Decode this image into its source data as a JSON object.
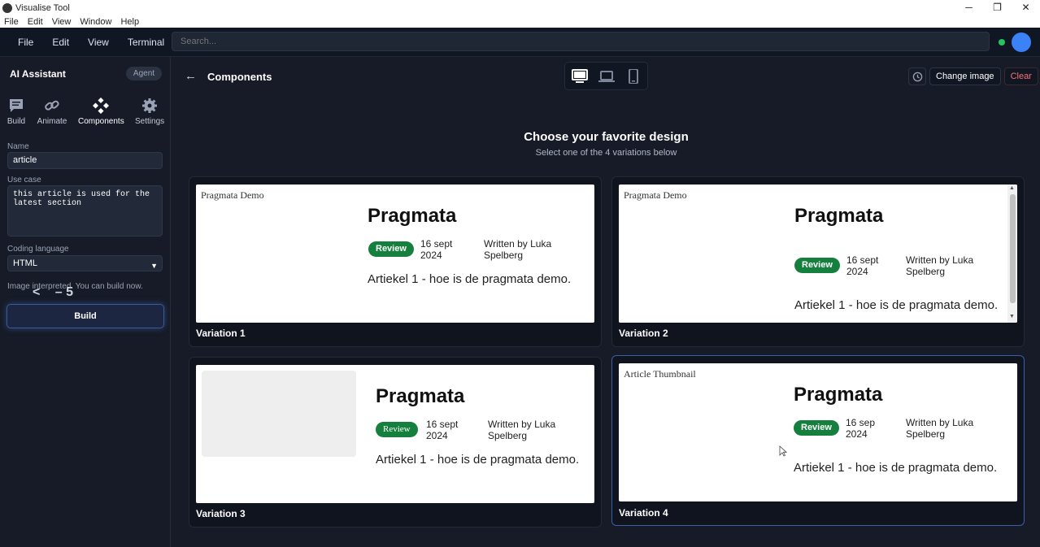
{
  "window": {
    "title": "Visualise Tool",
    "menu": [
      "File",
      "Edit",
      "View",
      "Window",
      "Help"
    ],
    "controls": [
      "─",
      "❐",
      "✕"
    ]
  },
  "appbar": {
    "menu": [
      "File",
      "Edit",
      "View",
      "Terminal"
    ],
    "search_placeholder": "Search...",
    "status_color": "#22c55e",
    "avatar_color": "#3b82f6"
  },
  "sidebar": {
    "title": "AI Assistant",
    "agent_badge": "Agent",
    "tabs": [
      {
        "label": "Build",
        "icon": "chat-icon"
      },
      {
        "label": "Animate",
        "icon": "link-icon"
      },
      {
        "label": "Components",
        "icon": "components-icon"
      },
      {
        "label": "Settings",
        "icon": "gear-icon"
      }
    ],
    "name_label": "Name",
    "name_value": "article",
    "usecase_label": "Use case",
    "usecase_value": "this article is used for the latest section",
    "language_label": "Coding language",
    "language_value": "HTML",
    "status_text": "Image interpreted. You can build now.",
    "overlay_arrow": "<",
    "overlay_text": "– 5",
    "build_label": "Build"
  },
  "main": {
    "back_label": "←",
    "title": "Components",
    "change_image_label": "Change image",
    "clear_label": "Clear",
    "choose_title": "Choose your favorite design",
    "choose_subtitle": "Select one of the 4 variations below",
    "variations": [
      {
        "label": "Variation 1",
        "img_alt": "Pragmata Demo",
        "title": "Pragmata",
        "badge": "Review",
        "date": "16 sept 2024",
        "author": "Written by Luka Spelberg",
        "text": "Artiekel 1 - hoe is de pragmata demo."
      },
      {
        "label": "Variation 2",
        "img_alt": "Pragmata Demo",
        "title": "Pragmata",
        "badge": "Review",
        "date": "16 sept 2024",
        "author": "Written by Luka Spelberg",
        "text": "Artiekel 1 - hoe is de pragmata demo."
      },
      {
        "label": "Variation 3",
        "title": "Pragmata",
        "badge": "Review",
        "date": "16 sept 2024",
        "author": "Written by Luka Spelberg",
        "text": "Artiekel 1 - hoe is de pragmata demo."
      },
      {
        "label": "Variation 4",
        "img_alt": "Article Thumbnail",
        "title": "Pragmata",
        "badge": "Review",
        "date": "16 sep 2024",
        "author": "Written by Luka Spelberg",
        "text": "Artiekel 1 - hoe is de pragmata demo."
      }
    ],
    "badge_color": "#15803d",
    "clear_color": "#f87171",
    "accent_color": "#3b5fa8"
  }
}
